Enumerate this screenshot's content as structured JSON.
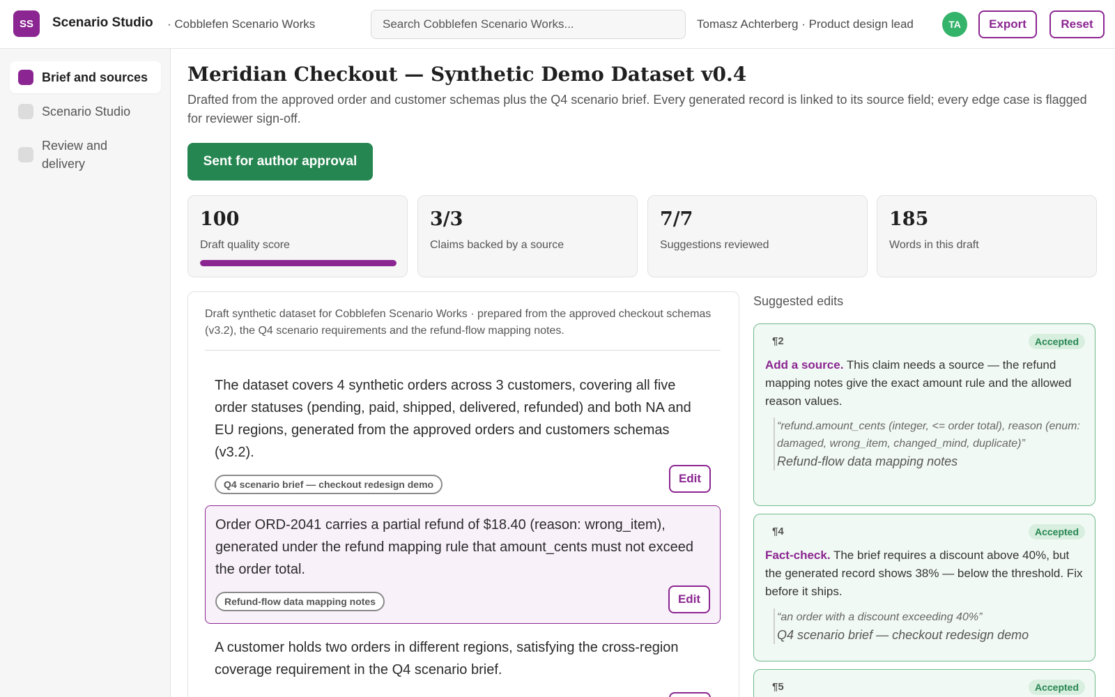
{
  "app": {
    "logo_initials": "SS",
    "title": "Scenario Studio",
    "workspace": "· Cobblefen Scenario Works",
    "search_placeholder": "Search Cobblefen Scenario Works...",
    "user_label": "Tomasz Achterberg · Product design lead",
    "avatar_initials": "TA",
    "export_label": "Export",
    "reset_label": "Reset"
  },
  "sidebar": {
    "items": [
      {
        "label": "Brief and sources",
        "active": true
      },
      {
        "label": "Scenario Studio",
        "active": false
      },
      {
        "label": "Review and delivery",
        "active": false
      }
    ]
  },
  "page": {
    "title": "Meridian Checkout — Synthetic Demo Dataset v0.4",
    "description": "Drafted from the approved order and customer schemas plus the Q4 scenario brief. Every generated record is linked to its source field; every edge case is flagged for reviewer sign-off.",
    "status_button": "Sent for author approval"
  },
  "stats": [
    {
      "value": "100",
      "label": "Draft quality score",
      "progress": 1.0
    },
    {
      "value": "3/3",
      "label": "Claims backed by a source"
    },
    {
      "value": "7/7",
      "label": "Suggestions reviewed"
    },
    {
      "value": "185",
      "label": "Words in this draft"
    }
  ],
  "draft": {
    "intro": "Draft synthetic dataset for Cobblefen Scenario Works · prepared from the approved checkout schemas (v3.2), the Q4 scenario requirements and the refund-flow mapping notes.",
    "edit_label": "Edit",
    "paragraphs": [
      {
        "text": "The dataset covers 4 synthetic orders across 3 customers, covering all five order statuses (pending, paid, shipped, delivered, refunded) and both NA and EU regions, generated from the approved orders and customers schemas (v3.2).",
        "source": "Q4 scenario brief — checkout redesign demo"
      },
      {
        "text": "Order ORD-2041 carries a partial refund of $18.40 (reason: wrong_item), generated under the refund mapping rule that amount_cents must not exceed the order total.",
        "source": "Refund-flow data mapping notes",
        "active": true
      },
      {
        "text": "A customer holds two orders in different regions, satisfying the cross-region coverage requirement in the Q4 scenario brief.",
        "source": ""
      }
    ]
  },
  "suggestions": {
    "title": "Suggested edits",
    "items": [
      {
        "para": "¶2",
        "status": "Accepted",
        "kind": "Add a source.",
        "body": "This claim needs a source — the refund mapping notes give the exact amount rule and the allowed reason values.",
        "quote": "“refund.amount_cents (integer, <= order total), reason (enum: damaged, wrong_item, changed_mind, duplicate)”",
        "source": "Refund-flow data mapping notes"
      },
      {
        "para": "¶4",
        "status": "Accepted",
        "kind": "Fact-check.",
        "body": "The brief requires a discount above 40%, but the generated record shows 38% — below the threshold. Fix before it ships.",
        "quote": "“an order with a discount exceeding 40%”",
        "source": "Q4 scenario brief — checkout redesign demo"
      },
      {
        "para": "¶5",
        "status": "Accepted",
        "kind": "",
        "body": "",
        "quote": "",
        "source": ""
      }
    ]
  },
  "colors": {
    "accent": "#8b2591",
    "success": "#268651",
    "avatar": "#34b36a"
  }
}
